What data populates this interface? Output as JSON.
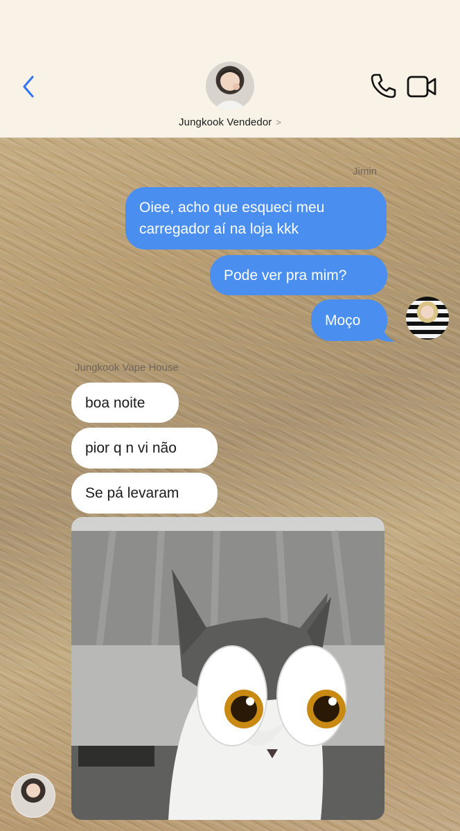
{
  "header": {
    "contact_name": "Jungkook Vendedor",
    "chevron": ">",
    "icons": {
      "back": "chevron-left-icon",
      "phone": "phone-icon",
      "video": "video-camera-icon"
    },
    "accent_color": "#3478f6"
  },
  "messages": {
    "outgoing_sender": "Jimin",
    "incoming_sender": "Jungkook Vape House",
    "outgoing": [
      "Oiee, acho que esqueci meu carregador aí na loja kkk",
      "Pode ver pra mim?",
      "Moço"
    ],
    "incoming": [
      "boa noite",
      "pior q n vi não",
      "Se pá levaram"
    ],
    "attachment": "cat-photo-with-cartoon-eyes"
  },
  "colors": {
    "outgoing_bubble": "#4a8ff0",
    "incoming_bubble": "#ffffff",
    "header_bg": "#f8f3e6"
  }
}
